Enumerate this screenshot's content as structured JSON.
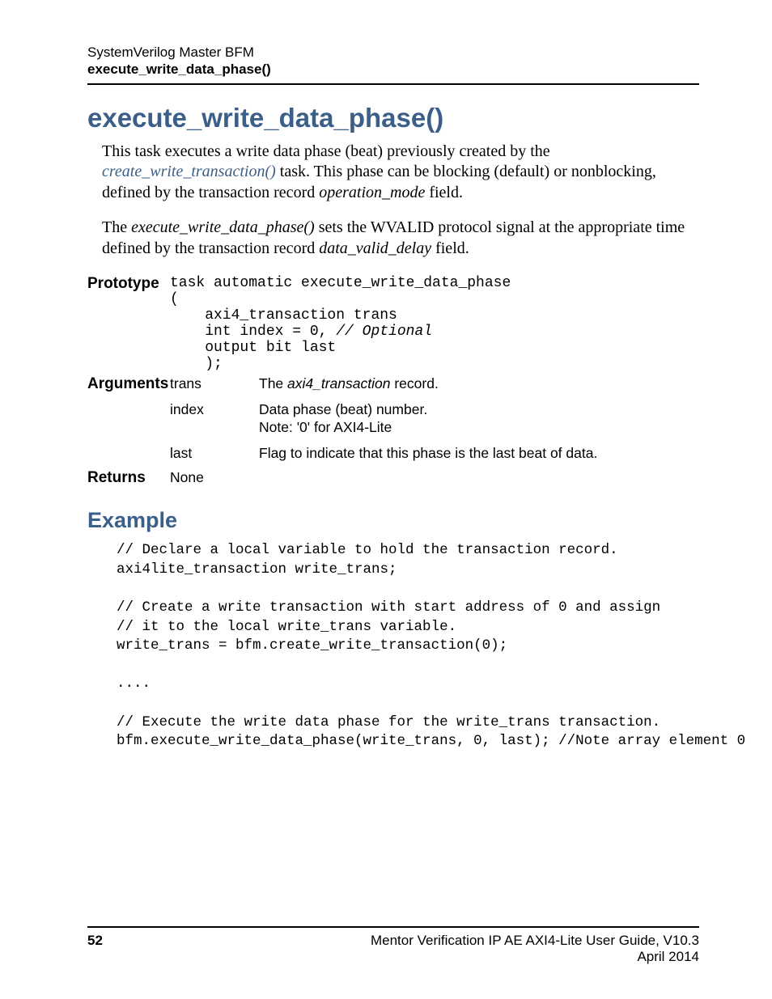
{
  "header": {
    "line1": "SystemVerilog Master BFM",
    "line2": "execute_write_data_phase()"
  },
  "title": "execute_write_data_phase()",
  "intro": {
    "p1_pre": "This task executes a write data phase (beat) previously created by the ",
    "p1_link": "create_write_transaction()",
    "p1_post1": " task. This phase can be blocking (default) or nonblocking, defined by the transaction record ",
    "p1_ital": "operation_mode",
    "p1_post2": " field.",
    "p2_pre": "The ",
    "p2_ital1": "execute_write_data_phase()",
    "p2_mid": " sets the WVALID protocol signal at the appropriate time defined by the transaction record ",
    "p2_ital2": "data_valid_delay",
    "p2_post": " field."
  },
  "labels": {
    "prototype": "Prototype",
    "arguments": "Arguments",
    "returns": "Returns"
  },
  "prototype": {
    "l1": "task automatic execute_write_data_phase",
    "l2": "(",
    "l3a": "    axi4_transaction trans",
    "l4a": "    int index = 0, ",
    "l4b": "// Optional",
    "l5a": "    output bit last",
    "l6": "    );"
  },
  "args": {
    "trans": {
      "name": "trans",
      "desc_pre": "The ",
      "desc_ital": "axi4_transaction",
      "desc_post": " record."
    },
    "index": {
      "name": "index",
      "desc1": "Data phase (beat) number.",
      "desc2": "Note: '0' for AXI4-Lite"
    },
    "last": {
      "name": "last",
      "desc": "Flag to indicate that this phase is the last beat of data."
    }
  },
  "returns": "None",
  "example_heading": "Example",
  "code": {
    "l1": "// Declare a local variable to hold the transaction record.",
    "l2": "axi4lite_transaction write_trans;",
    "l3": "",
    "l4": "// Create a write transaction with start address of 0 and assign",
    "l5": "// it to the local write_trans variable.",
    "l6": "write_trans = bfm.create_write_transaction(0);",
    "l7": "",
    "l8": "....",
    "l9": "",
    "l10": "// Execute the write data phase for the write_trans transaction.",
    "l11": "bfm.execute_write_data_phase(write_trans, 0, last); //Note array element 0"
  },
  "footer": {
    "page": "52",
    "guide": "Mentor Verification IP AE AXI4-Lite User Guide, V10.3",
    "date": "April 2014"
  }
}
